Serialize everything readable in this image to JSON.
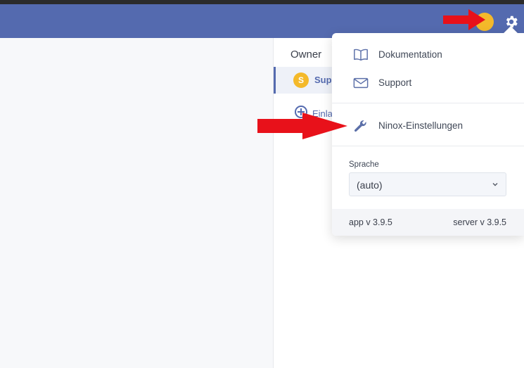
{
  "sharing": {
    "owner_label": "Owner",
    "owner_initial": "S",
    "owner_name_truncated": "Sup",
    "invite_truncated": "Einla"
  },
  "menu": {
    "items": [
      {
        "label": "Dokumentation",
        "icon": "book-icon"
      },
      {
        "label": "Support",
        "icon": "mail-icon"
      },
      {
        "label": "Ninox-Einstellungen",
        "icon": "wrench-icon"
      }
    ],
    "language_label": "Sprache",
    "language_value": "(auto)",
    "app_version": "app v 3.9.5",
    "server_version": "server v 3.9.5"
  },
  "colors": {
    "header": "#546aaf",
    "accent": "#546aaf",
    "avatar": "#f4b92a",
    "arrow": "#e8111a"
  }
}
